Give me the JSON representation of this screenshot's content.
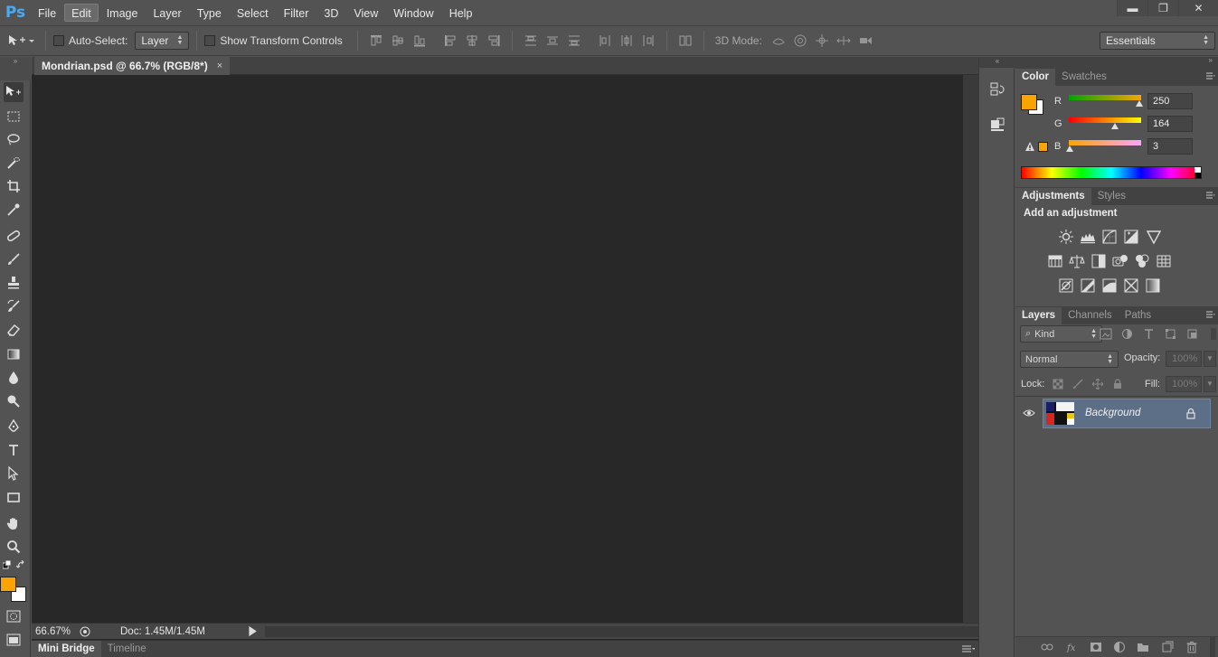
{
  "app": {
    "logo": "Ps"
  },
  "menu": {
    "items": [
      "File",
      "Edit",
      "Image",
      "Layer",
      "Type",
      "Select",
      "Filter",
      "3D",
      "View",
      "Window",
      "Help"
    ],
    "active": "Edit"
  },
  "window_controls": {
    "minimize": "▬",
    "restore": "❐",
    "close": "✕"
  },
  "options": {
    "auto_select_label": "Auto-Select:",
    "auto_select_checked": false,
    "auto_select_target": "Layer",
    "show_transform_label": "Show Transform Controls",
    "show_transform_checked": false,
    "mode_3d_label": "3D Mode:",
    "workspace": "Essentials"
  },
  "document": {
    "tab_title": "Mondrian.psd @ 66.7% (RGB/8*)",
    "tab_close": "×",
    "zoom": "66.67%",
    "doc_info": "Doc: 1.45M/1.45M"
  },
  "bottom_tabs": [
    {
      "label": "Mini Bridge",
      "active": true
    },
    {
      "label": "Timeline",
      "active": false
    }
  ],
  "color_panel": {
    "tabs": [
      {
        "label": "Color",
        "active": true
      },
      {
        "label": "Swatches",
        "active": false
      }
    ],
    "foreground": "#faa403",
    "background": "#ffffff",
    "channels": [
      {
        "label": "R",
        "value": "250"
      },
      {
        "label": "G",
        "value": "164"
      },
      {
        "label": "B",
        "value": "3"
      }
    ]
  },
  "adjustments_panel": {
    "tabs": [
      {
        "label": "Adjustments",
        "active": true
      },
      {
        "label": "Styles",
        "active": false
      }
    ],
    "heading": "Add an adjustment"
  },
  "layers_panel": {
    "tabs": [
      {
        "label": "Layers",
        "active": true
      },
      {
        "label": "Channels",
        "active": false
      },
      {
        "label": "Paths",
        "active": false
      }
    ],
    "filter_kind": "Kind",
    "blend_mode": "Normal",
    "opacity_label": "Opacity:",
    "opacity_value": "100%",
    "lock_label": "Lock:",
    "fill_label": "Fill:",
    "fill_value": "100%",
    "layers": [
      {
        "name": "Background",
        "visible": true,
        "locked": true
      }
    ]
  },
  "colors": {
    "accent_orange": "#faa403",
    "selected_layer": "#5d6f86",
    "logo_blue": "#4aa9f0"
  }
}
